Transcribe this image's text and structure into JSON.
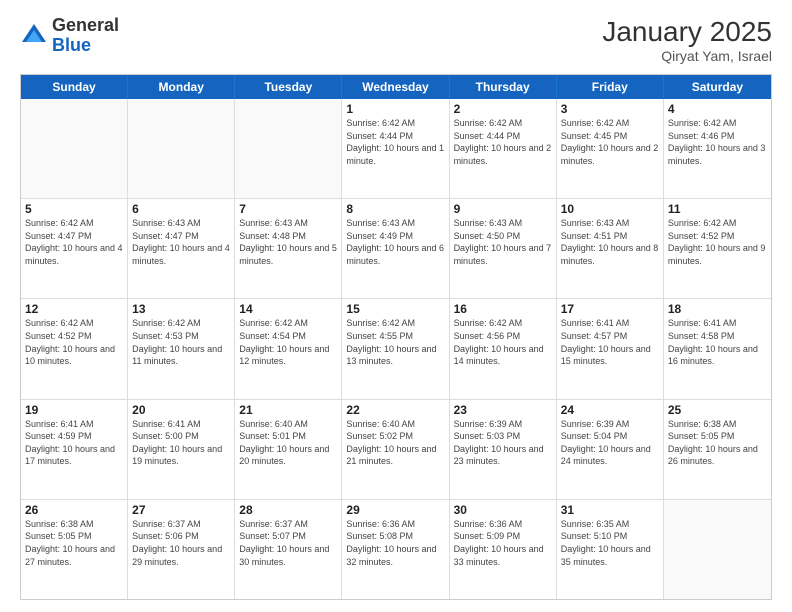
{
  "header": {
    "logo_general": "General",
    "logo_blue": "Blue",
    "month_title": "January 2025",
    "location": "Qiryat Yam, Israel"
  },
  "weekdays": [
    "Sunday",
    "Monday",
    "Tuesday",
    "Wednesday",
    "Thursday",
    "Friday",
    "Saturday"
  ],
  "rows": [
    [
      {
        "day": "",
        "sunrise": "",
        "sunset": "",
        "daylight": ""
      },
      {
        "day": "",
        "sunrise": "",
        "sunset": "",
        "daylight": ""
      },
      {
        "day": "",
        "sunrise": "",
        "sunset": "",
        "daylight": ""
      },
      {
        "day": "1",
        "sunrise": "Sunrise: 6:42 AM",
        "sunset": "Sunset: 4:44 PM",
        "daylight": "Daylight: 10 hours and 1 minute."
      },
      {
        "day": "2",
        "sunrise": "Sunrise: 6:42 AM",
        "sunset": "Sunset: 4:44 PM",
        "daylight": "Daylight: 10 hours and 2 minutes."
      },
      {
        "day": "3",
        "sunrise": "Sunrise: 6:42 AM",
        "sunset": "Sunset: 4:45 PM",
        "daylight": "Daylight: 10 hours and 2 minutes."
      },
      {
        "day": "4",
        "sunrise": "Sunrise: 6:42 AM",
        "sunset": "Sunset: 4:46 PM",
        "daylight": "Daylight: 10 hours and 3 minutes."
      }
    ],
    [
      {
        "day": "5",
        "sunrise": "Sunrise: 6:42 AM",
        "sunset": "Sunset: 4:47 PM",
        "daylight": "Daylight: 10 hours and 4 minutes."
      },
      {
        "day": "6",
        "sunrise": "Sunrise: 6:43 AM",
        "sunset": "Sunset: 4:47 PM",
        "daylight": "Daylight: 10 hours and 4 minutes."
      },
      {
        "day": "7",
        "sunrise": "Sunrise: 6:43 AM",
        "sunset": "Sunset: 4:48 PM",
        "daylight": "Daylight: 10 hours and 5 minutes."
      },
      {
        "day": "8",
        "sunrise": "Sunrise: 6:43 AM",
        "sunset": "Sunset: 4:49 PM",
        "daylight": "Daylight: 10 hours and 6 minutes."
      },
      {
        "day": "9",
        "sunrise": "Sunrise: 6:43 AM",
        "sunset": "Sunset: 4:50 PM",
        "daylight": "Daylight: 10 hours and 7 minutes."
      },
      {
        "day": "10",
        "sunrise": "Sunrise: 6:43 AM",
        "sunset": "Sunset: 4:51 PM",
        "daylight": "Daylight: 10 hours and 8 minutes."
      },
      {
        "day": "11",
        "sunrise": "Sunrise: 6:42 AM",
        "sunset": "Sunset: 4:52 PM",
        "daylight": "Daylight: 10 hours and 9 minutes."
      }
    ],
    [
      {
        "day": "12",
        "sunrise": "Sunrise: 6:42 AM",
        "sunset": "Sunset: 4:52 PM",
        "daylight": "Daylight: 10 hours and 10 minutes."
      },
      {
        "day": "13",
        "sunrise": "Sunrise: 6:42 AM",
        "sunset": "Sunset: 4:53 PM",
        "daylight": "Daylight: 10 hours and 11 minutes."
      },
      {
        "day": "14",
        "sunrise": "Sunrise: 6:42 AM",
        "sunset": "Sunset: 4:54 PM",
        "daylight": "Daylight: 10 hours and 12 minutes."
      },
      {
        "day": "15",
        "sunrise": "Sunrise: 6:42 AM",
        "sunset": "Sunset: 4:55 PM",
        "daylight": "Daylight: 10 hours and 13 minutes."
      },
      {
        "day": "16",
        "sunrise": "Sunrise: 6:42 AM",
        "sunset": "Sunset: 4:56 PM",
        "daylight": "Daylight: 10 hours and 14 minutes."
      },
      {
        "day": "17",
        "sunrise": "Sunrise: 6:41 AM",
        "sunset": "Sunset: 4:57 PM",
        "daylight": "Daylight: 10 hours and 15 minutes."
      },
      {
        "day": "18",
        "sunrise": "Sunrise: 6:41 AM",
        "sunset": "Sunset: 4:58 PM",
        "daylight": "Daylight: 10 hours and 16 minutes."
      }
    ],
    [
      {
        "day": "19",
        "sunrise": "Sunrise: 6:41 AM",
        "sunset": "Sunset: 4:59 PM",
        "daylight": "Daylight: 10 hours and 17 minutes."
      },
      {
        "day": "20",
        "sunrise": "Sunrise: 6:41 AM",
        "sunset": "Sunset: 5:00 PM",
        "daylight": "Daylight: 10 hours and 19 minutes."
      },
      {
        "day": "21",
        "sunrise": "Sunrise: 6:40 AM",
        "sunset": "Sunset: 5:01 PM",
        "daylight": "Daylight: 10 hours and 20 minutes."
      },
      {
        "day": "22",
        "sunrise": "Sunrise: 6:40 AM",
        "sunset": "Sunset: 5:02 PM",
        "daylight": "Daylight: 10 hours and 21 minutes."
      },
      {
        "day": "23",
        "sunrise": "Sunrise: 6:39 AM",
        "sunset": "Sunset: 5:03 PM",
        "daylight": "Daylight: 10 hours and 23 minutes."
      },
      {
        "day": "24",
        "sunrise": "Sunrise: 6:39 AM",
        "sunset": "Sunset: 5:04 PM",
        "daylight": "Daylight: 10 hours and 24 minutes."
      },
      {
        "day": "25",
        "sunrise": "Sunrise: 6:38 AM",
        "sunset": "Sunset: 5:05 PM",
        "daylight": "Daylight: 10 hours and 26 minutes."
      }
    ],
    [
      {
        "day": "26",
        "sunrise": "Sunrise: 6:38 AM",
        "sunset": "Sunset: 5:05 PM",
        "daylight": "Daylight: 10 hours and 27 minutes."
      },
      {
        "day": "27",
        "sunrise": "Sunrise: 6:37 AM",
        "sunset": "Sunset: 5:06 PM",
        "daylight": "Daylight: 10 hours and 29 minutes."
      },
      {
        "day": "28",
        "sunrise": "Sunrise: 6:37 AM",
        "sunset": "Sunset: 5:07 PM",
        "daylight": "Daylight: 10 hours and 30 minutes."
      },
      {
        "day": "29",
        "sunrise": "Sunrise: 6:36 AM",
        "sunset": "Sunset: 5:08 PM",
        "daylight": "Daylight: 10 hours and 32 minutes."
      },
      {
        "day": "30",
        "sunrise": "Sunrise: 6:36 AM",
        "sunset": "Sunset: 5:09 PM",
        "daylight": "Daylight: 10 hours and 33 minutes."
      },
      {
        "day": "31",
        "sunrise": "Sunrise: 6:35 AM",
        "sunset": "Sunset: 5:10 PM",
        "daylight": "Daylight: 10 hours and 35 minutes."
      },
      {
        "day": "",
        "sunrise": "",
        "sunset": "",
        "daylight": ""
      }
    ]
  ]
}
